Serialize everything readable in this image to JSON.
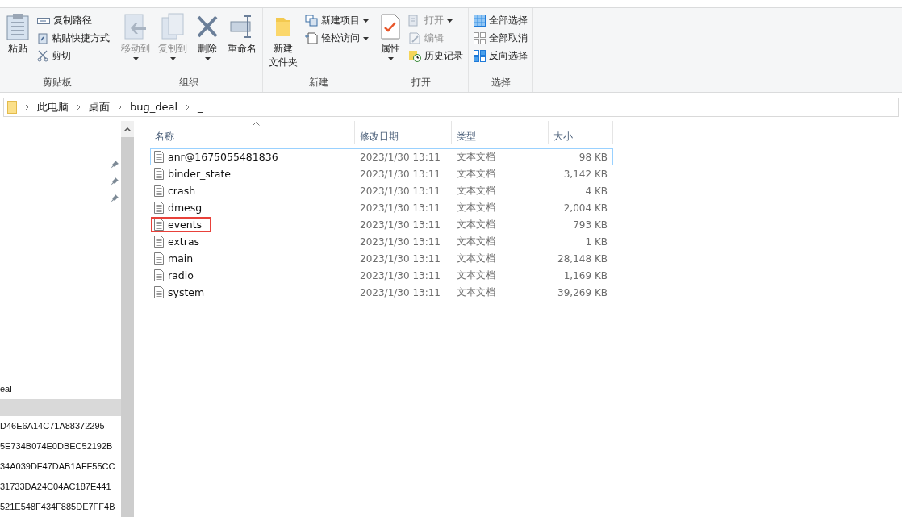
{
  "ribbon": {
    "groups": [
      {
        "label": "剪贴板",
        "large": [
          {
            "lines": [
              "粘贴"
            ],
            "disabled": false,
            "dropdown": false
          }
        ],
        "small": [
          {
            "label": "复制路径",
            "disabled": false,
            "dropdown": false
          },
          {
            "label": "粘贴快捷方式",
            "disabled": false,
            "dropdown": false
          },
          {
            "label": "剪切",
            "disabled": false,
            "dropdown": false
          }
        ]
      },
      {
        "label": "组织",
        "large": [
          {
            "lines": [
              "移动到"
            ],
            "disabled": true,
            "dropdown": true
          },
          {
            "lines": [
              "复制到"
            ],
            "disabled": true,
            "dropdown": true
          },
          {
            "lines": [
              "删除"
            ],
            "disabled": false,
            "dropdown": true
          },
          {
            "lines": [
              "重命名"
            ],
            "disabled": false,
            "dropdown": false
          }
        ]
      },
      {
        "label": "新建",
        "large": [
          {
            "lines": [
              "新建",
              "文件夹"
            ],
            "disabled": false,
            "dropdown": false
          }
        ],
        "small": [
          {
            "label": "新建项目",
            "disabled": false,
            "dropdown": true
          },
          {
            "label": "轻松访问",
            "disabled": false,
            "dropdown": true
          }
        ]
      },
      {
        "label": "打开",
        "large": [
          {
            "lines": [
              "属性"
            ],
            "disabled": false,
            "dropdown": true
          }
        ],
        "small": [
          {
            "label": "打开",
            "disabled": true,
            "dropdown": true
          },
          {
            "label": "编辑",
            "disabled": true,
            "dropdown": false
          },
          {
            "label": "历史记录",
            "disabled": false,
            "dropdown": false
          }
        ]
      },
      {
        "label": "选择",
        "small": [
          {
            "label": "全部选择",
            "disabled": false,
            "dropdown": false
          },
          {
            "label": "全部取消",
            "disabled": false,
            "dropdown": false
          },
          {
            "label": "反向选择",
            "disabled": false,
            "dropdown": false
          }
        ]
      }
    ]
  },
  "breadcrumb": [
    "此电脑",
    "桌面",
    "bug_deal",
    "_"
  ],
  "nav_pane": {
    "items": [
      {
        "label": "eal",
        "selected": false
      },
      {
        "selected": true
      },
      {
        "label": "D46E6A14C71A88372295",
        "selected": false
      },
      {
        "label": "5E734B074E0DBEC52192B",
        "selected": false
      },
      {
        "label": "34A039DF47DAB1AFF55CC",
        "selected": false
      },
      {
        "label": "31733DA24C04AC187E441",
        "selected": false
      },
      {
        "label": "521E548F434F885DE7FF4B",
        "selected": false
      }
    ]
  },
  "table": {
    "columns": [
      {
        "label": "名称",
        "sorted": true
      },
      {
        "label": "修改日期",
        "sorted": false
      },
      {
        "label": "类型",
        "sorted": false
      },
      {
        "label": "大小",
        "sorted": false
      }
    ],
    "rows": [
      {
        "name": "anr@1675055481836",
        "date": "2023/1/30 13:11",
        "type": "文本文档",
        "size": "98 KB",
        "focused": true,
        "marked": false
      },
      {
        "name": "binder_state",
        "date": "2023/1/30 13:11",
        "type": "文本文档",
        "size": "3,142 KB",
        "focused": false,
        "marked": false
      },
      {
        "name": "crash",
        "date": "2023/1/30 13:11",
        "type": "文本文档",
        "size": "4 KB",
        "focused": false,
        "marked": false
      },
      {
        "name": "dmesg",
        "date": "2023/1/30 13:11",
        "type": "文本文档",
        "size": "2,004 KB",
        "focused": false,
        "marked": false
      },
      {
        "name": "events",
        "date": "2023/1/30 13:11",
        "type": "文本文档",
        "size": "793 KB",
        "focused": false,
        "marked": true
      },
      {
        "name": "extras",
        "date": "2023/1/30 13:11",
        "type": "文本文档",
        "size": "1 KB",
        "focused": false,
        "marked": false
      },
      {
        "name": "main",
        "date": "2023/1/30 13:11",
        "type": "文本文档",
        "size": "28,148 KB",
        "focused": false,
        "marked": false
      },
      {
        "name": "radio",
        "date": "2023/1/30 13:11",
        "type": "文本文档",
        "size": "1,169 KB",
        "focused": false,
        "marked": false
      },
      {
        "name": "system",
        "date": "2023/1/30 13:11",
        "type": "文本文档",
        "size": "39,269 KB",
        "focused": false,
        "marked": false
      }
    ]
  }
}
